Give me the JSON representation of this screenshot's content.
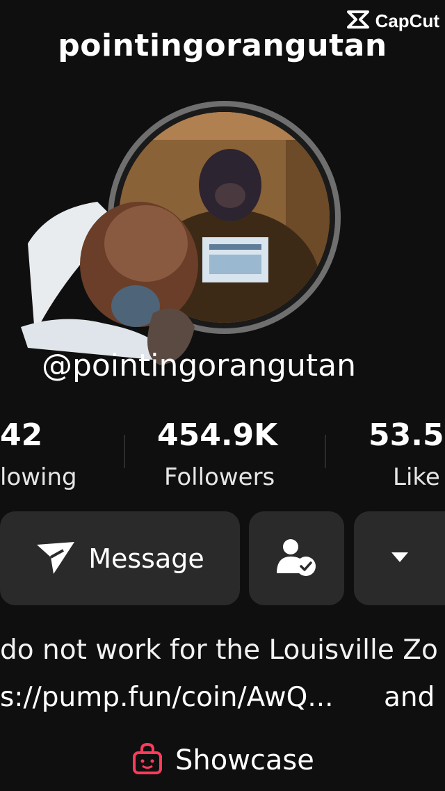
{
  "watermark": {
    "text": "CapCut",
    "icon": "capcut-logo-icon"
  },
  "profile": {
    "title_username": "pointingorangutan",
    "handle": "@pointingorangutan",
    "avatar_icon": "orangutan-avatar"
  },
  "stats": {
    "following": {
      "value": "42",
      "label": "lowing"
    },
    "followers": {
      "value": "454.9K",
      "label": "Followers"
    },
    "likes": {
      "value": "53.5",
      "label": "Like"
    }
  },
  "actions": {
    "message_label": "Message",
    "message_icon": "send-arrow-icon",
    "friend_icon": "user-check-icon",
    "more_icon": "triangle-down-icon"
  },
  "bio": {
    "text": "do not work for the Louisville Zo",
    "link_text": "s://pump.fun/coin/AwQ...",
    "link_suffix": "and"
  },
  "showcase": {
    "label": "Showcase",
    "icon": "shopping-bag-icon",
    "icon_color": "#ff3b5c"
  }
}
